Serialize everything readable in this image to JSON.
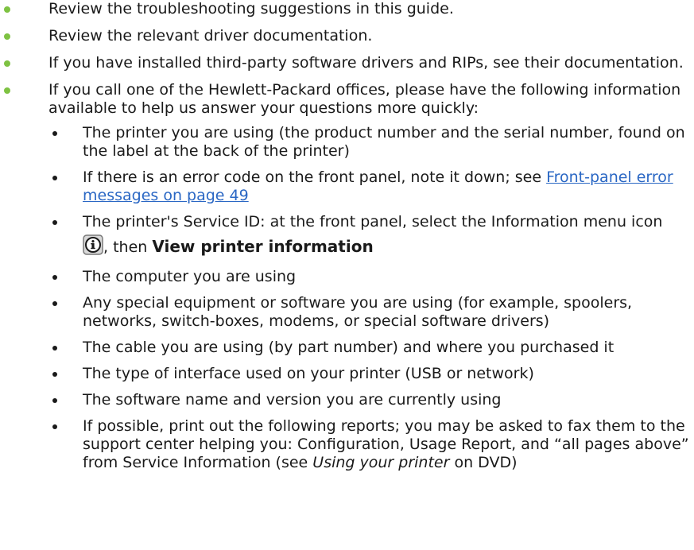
{
  "items": [
    {
      "text": "Review the troubleshooting suggestions in this guide."
    },
    {
      "text": "Review the relevant driver documentation."
    },
    {
      "text": "If you have installed third-party software drivers and RIPs, see their documentation."
    },
    {
      "text": "If you call one of the Hewlett-Packard offices, please have the following information available to help us answer your questions more quickly:",
      "subitems": [
        {
          "text": "The printer you are using (the product number and the serial number, found on the label at the back of the printer)"
        },
        {
          "text": "If there is an error code on the front panel, note it down; see ",
          "link": "Front-panel error messages on page 49"
        },
        {
          "text_before_icon": "The printer's Service ID: at the front panel, select the Information menu icon",
          "icon": "information-menu-icon",
          "text_after_icon": ", then ",
          "bold": "View printer information"
        },
        {
          "text": "The computer you are using"
        },
        {
          "text": "Any special equipment or software you are using (for example, spoolers, networks, switch-boxes, modems, or special software drivers)"
        },
        {
          "text": "The cable you are using (by part number) and where you purchased it"
        },
        {
          "text": "The type of interface used on your printer (USB or network)"
        },
        {
          "text": "The software name and version you are currently using"
        },
        {
          "text": "If possible, print out the following reports; you may be asked to fax them to the support center helping you: Configuration, Usage Report, and “all pages above” from Service Information (see ",
          "italic": "Using your printer",
          "text_after": " on DVD)"
        }
      ]
    }
  ],
  "colors": {
    "bullet_level1": "#7ec242",
    "link": "#2a67c4",
    "text": "#1a1a1a"
  }
}
